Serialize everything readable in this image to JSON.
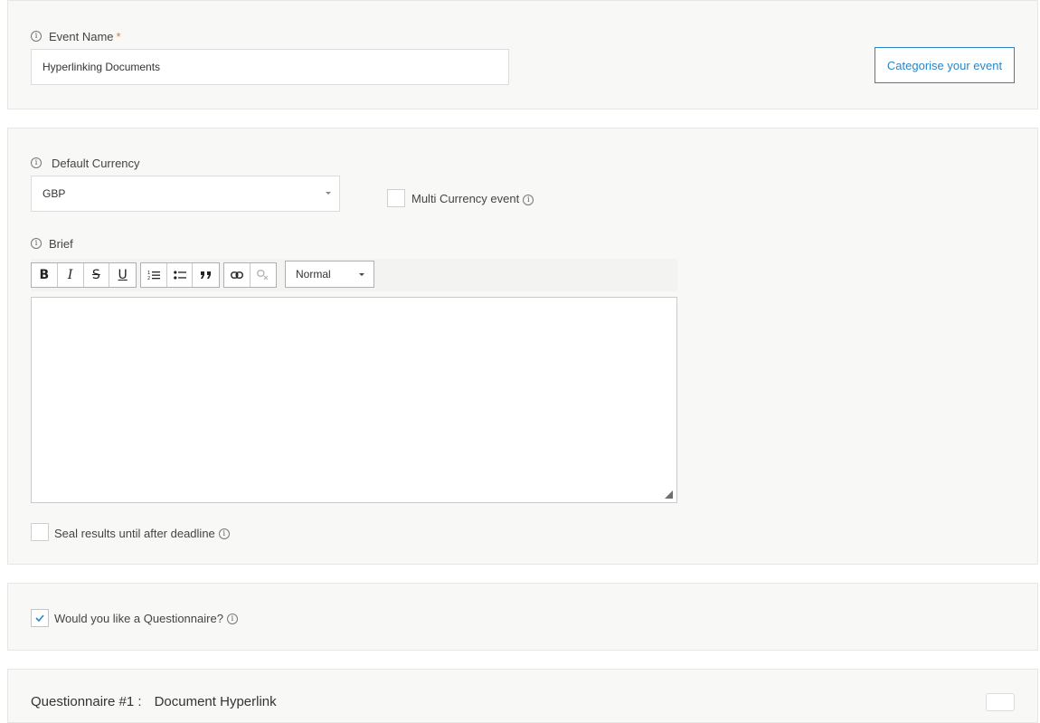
{
  "event": {
    "name_label": "Event Name",
    "required_marker": "*",
    "name_value": "Hyperlinking Documents",
    "categorise_button": "Categorise your event"
  },
  "currency": {
    "label": "Default Currency",
    "selected": "GBP",
    "multi_currency_label": "Multi Currency event"
  },
  "brief": {
    "label": "Brief",
    "toolbar": {
      "bold": "B",
      "italic": "I",
      "strike": "S",
      "underline": "U",
      "format_selected": "Normal"
    },
    "content": ""
  },
  "seal": {
    "label": "Seal results until after deadline",
    "checked": false
  },
  "questionnaire": {
    "prompt": "Would you like a Questionnaire?",
    "checked": true,
    "header_title": "Questionnaire #1 :",
    "header_name": "Document Hyperlink"
  },
  "icons": {
    "info": "info-icon",
    "dropdown": "chevron-down-icon",
    "checkmark": "checkmark-icon"
  },
  "colors": {
    "accent": "#2a86c8",
    "required": "#e07b2a",
    "panel_bg": "#f8f8f6"
  }
}
